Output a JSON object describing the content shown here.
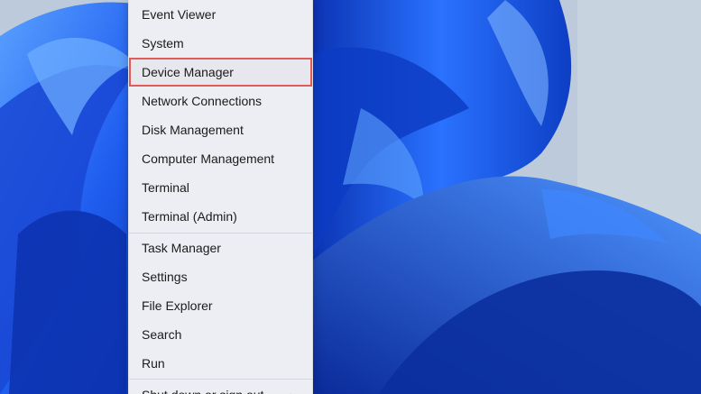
{
  "menu": {
    "group1": [
      {
        "name": "menu-item-event-viewer",
        "label": "Event Viewer"
      },
      {
        "name": "menu-item-system",
        "label": "System"
      },
      {
        "name": "menu-item-device-manager",
        "label": "Device Manager",
        "highlighted": true
      },
      {
        "name": "menu-item-network-connections",
        "label": "Network Connections"
      },
      {
        "name": "menu-item-disk-management",
        "label": "Disk Management"
      },
      {
        "name": "menu-item-computer-management",
        "label": "Computer Management"
      },
      {
        "name": "menu-item-terminal",
        "label": "Terminal"
      },
      {
        "name": "menu-item-terminal-admin",
        "label": "Terminal (Admin)"
      }
    ],
    "group2": [
      {
        "name": "menu-item-task-manager",
        "label": "Task Manager"
      },
      {
        "name": "menu-item-settings",
        "label": "Settings"
      },
      {
        "name": "menu-item-file-explorer",
        "label": "File Explorer"
      },
      {
        "name": "menu-item-search",
        "label": "Search"
      },
      {
        "name": "menu-item-run",
        "label": "Run"
      }
    ],
    "shutdown": {
      "label": "Shut down or sign out",
      "chevron": "›"
    }
  },
  "colors": {
    "highlight_outline": "#e05a5a",
    "wallpaper_blue": "#1f57e8",
    "wallpaper_bg": "#b9c6d6"
  },
  "icons": [
    "chevron-right-icon"
  ]
}
